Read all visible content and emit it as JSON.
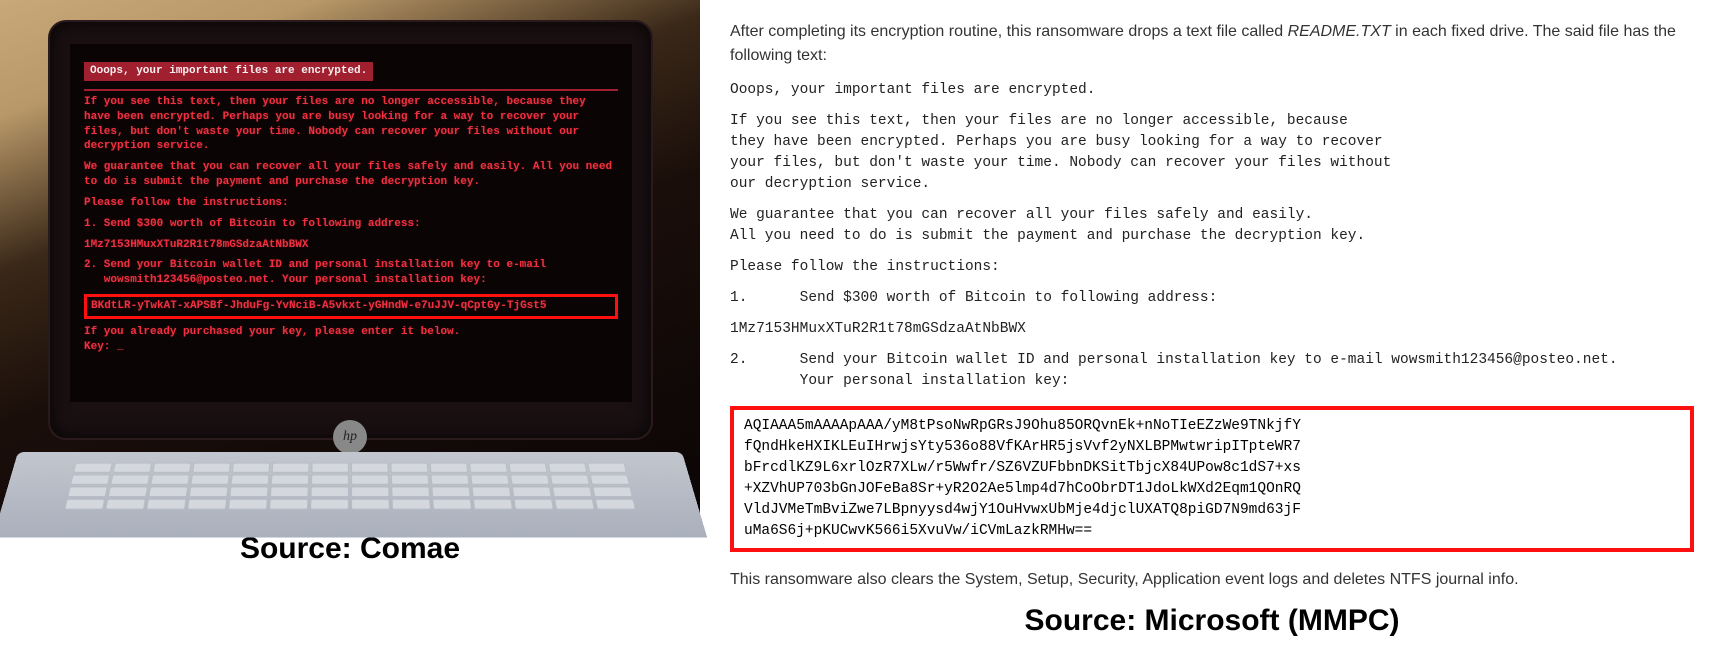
{
  "left": {
    "source": "Source: Comae",
    "hp": "hp",
    "screen": {
      "header": "Ooops, your important files are encrypted.",
      "p1": "If you see this text, then your files are no longer accessible, because they have been encrypted.  Perhaps you are busy looking for a way to recover your files, but don't waste your time.  Nobody can recover your files without our decryption service.",
      "p2": "We guarantee that you can recover all your files safely and easily.  All you need to do is submit the payment and purchase the decryption key.",
      "p3": "Please follow the instructions:",
      "p4": "1. Send $300 worth of Bitcoin to following address:",
      "p5": "   1Mz7153HMuxXTuR2R1t78mGSdzaAtNbBWX",
      "p6": "2. Send your Bitcoin wallet ID and personal installation key to e-mail\n   wowsmith123456@posteo.net. Your personal installation key:",
      "key": "   BKdtLR-yTwkAT-xAPSBf-JhduFg-YvNciB-A5vkxt-yGHndW-e7uJJV-qCptGy-TjGst5",
      "p7": "If you already purchased your key, please enter it below.\nKey: _"
    }
  },
  "right": {
    "intro_before": "After completing its encryption routine, this ransomware drops a text file called ",
    "intro_em": "README.TXT",
    "intro_after": " in each fixed drive. The said file has the following text:",
    "l1": "Ooops, your important files are encrypted.",
    "l2": "If you see this text, then your files are no longer accessible, because\nthey have been encrypted. Perhaps you are busy looking for a way to recover\nyour files, but don't waste your time. Nobody can recover your files without\nour decryption service.",
    "l3": "We guarantee that you can recover all your files safely and easily.\nAll you need to do is submit the payment and purchase the decryption key.",
    "l4": "Please follow the instructions:",
    "l5": "1.      Send $300 worth of Bitcoin to following address:",
    "l6": "1Mz7153HMuxXTuR2R1t78mGSdzaAtNbBWX",
    "l7": "2.      Send your Bitcoin wallet ID and personal installation key to e-mail wowsmith123456@posteo.net.\n        Your personal installation key:",
    "key": "AQIAAA5mAAAApAAA/yM8tPsoNwRpGRsJ9Ohu85ORQvnEk+nNoTIeEZzWe9TNkjfY\nfQndHkeHXIKLEuIHrwjsYty536o88VfKArHR5jsVvf2yNXLBPMwtwripITpteWR7\nbFrcdlKZ9L6xrlOzR7XLw/r5Wwfr/SZ6VZUFbbnDKSitTbjcX84UPow8c1dS7+xs\n+XZVhUP703bGnJOFeBa8Sr+yR2O2Ae5lmp4d7hCoObrDT1JdoLkWXd2Eqm1QOnRQ\nVldJVMeTmBviZwe7LBpnyysd4wjY1OuHvwxUbMje4djclUXATQ8piGD7N9md63jF\nuMa6S6j+pKUCwvK566i5XvuVw/iCVmLazkRMHw==",
    "outro": "This ransomware also clears the System, Setup, Security, Application event logs and deletes NTFS journal info.",
    "source": "Source: Microsoft (MMPC)"
  }
}
